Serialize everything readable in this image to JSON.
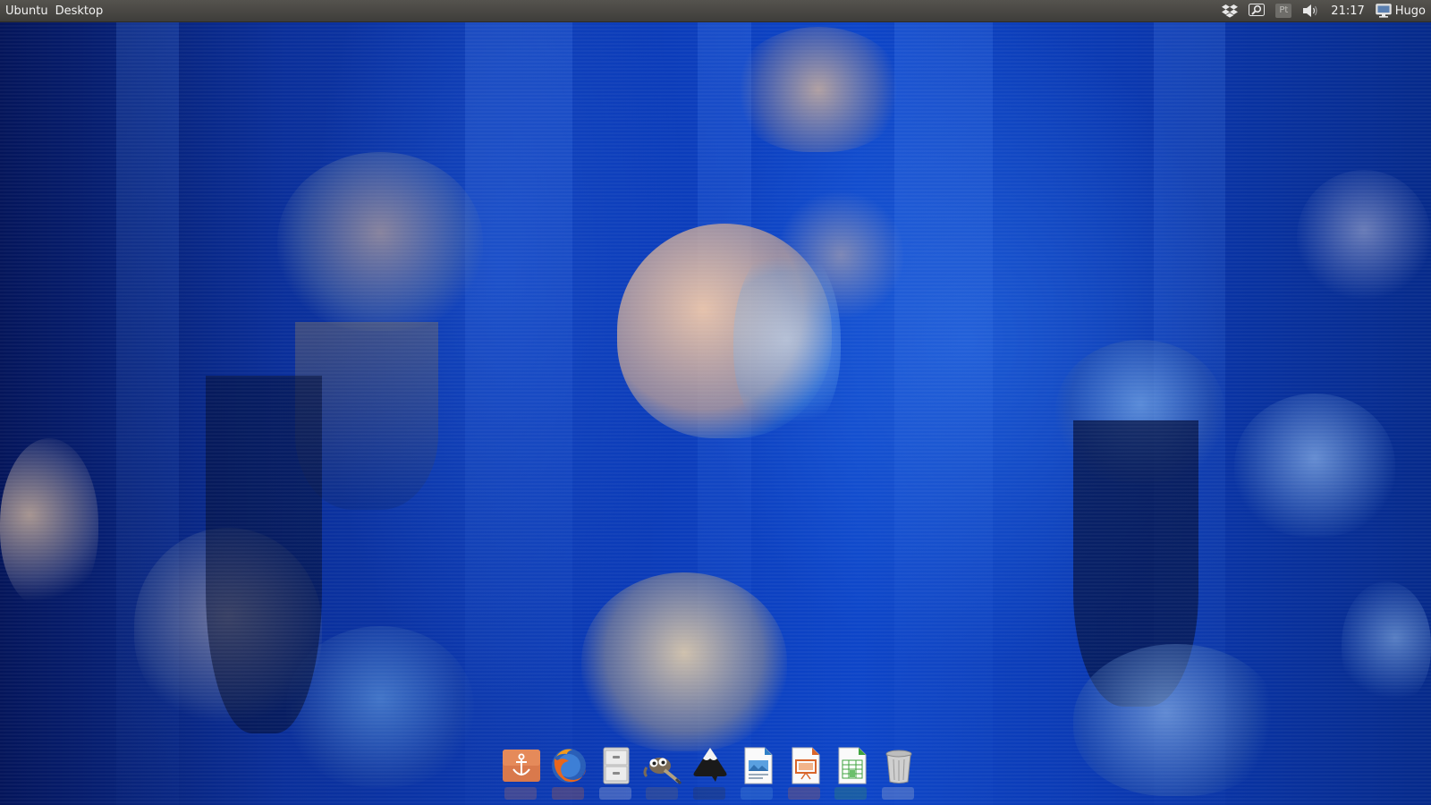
{
  "top_panel": {
    "menus": [
      "Ubuntu",
      "Desktop"
    ],
    "tray": {
      "icons": [
        "dropbox-icon",
        "search-icon",
        "keyboard-layout-icon",
        "volume-icon"
      ],
      "keyboard_layout": "Pt",
      "clock": "21:17",
      "user_icon": "monitor-icon",
      "user_name": "Hugo"
    }
  },
  "dock": {
    "items": [
      {
        "icon": "anchor-icon",
        "app": "Docky"
      },
      {
        "icon": "firefox-icon",
        "app": "Firefox"
      },
      {
        "icon": "file-cabinet-icon",
        "app": "Files"
      },
      {
        "icon": "gimp-icon",
        "app": "GIMP"
      },
      {
        "icon": "inkscape-icon",
        "app": "Inkscape"
      },
      {
        "icon": "libreoffice-writer-icon",
        "app": "LibreOffice Writer"
      },
      {
        "icon": "libreoffice-impress-icon",
        "app": "LibreOffice Impress"
      },
      {
        "icon": "libreoffice-calc-icon",
        "app": "LibreOffice Calc"
      },
      {
        "icon": "trash-icon",
        "app": "Trash"
      }
    ]
  },
  "colors": {
    "panel_bg": "#3e3d3a",
    "wallpaper_blue": "#0b3bb8"
  }
}
